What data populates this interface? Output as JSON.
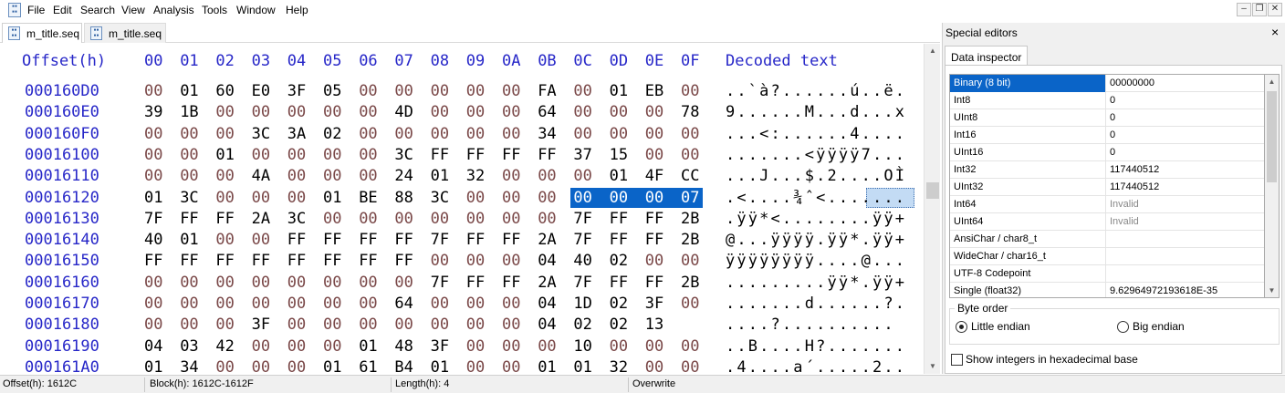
{
  "menu": [
    "File",
    "Edit",
    "Search",
    "View",
    "Analysis",
    "Tools",
    "Window",
    "Help"
  ],
  "window_controls": {
    "minimize": "–",
    "restore": "❐",
    "close": "✕"
  },
  "tabs": [
    {
      "label": "m_title.seq",
      "active": true
    },
    {
      "label": "m_title.seq",
      "active": false
    }
  ],
  "hex": {
    "header_offset": "Offset(h)",
    "columns": [
      "00",
      "01",
      "02",
      "03",
      "04",
      "05",
      "06",
      "07",
      "08",
      "09",
      "0A",
      "0B",
      "0C",
      "0D",
      "0E",
      "0F"
    ],
    "header_text": "Decoded text",
    "rows": [
      {
        "offset": "000160D0",
        "bytes": [
          "00",
          "01",
          "60",
          "E0",
          "3F",
          "05",
          "00",
          "00",
          "00",
          "00",
          "00",
          "FA",
          "00",
          "01",
          "EB",
          "00"
        ],
        "text": "..`à?......ú..ë."
      },
      {
        "offset": "000160E0",
        "bytes": [
          "39",
          "1B",
          "00",
          "00",
          "00",
          "00",
          "00",
          "4D",
          "00",
          "00",
          "00",
          "64",
          "00",
          "00",
          "00",
          "78"
        ],
        "text": "9......M...d...x"
      },
      {
        "offset": "000160F0",
        "bytes": [
          "00",
          "00",
          "00",
          "3C",
          "3A",
          "02",
          "00",
          "00",
          "00",
          "00",
          "00",
          "34",
          "00",
          "00",
          "00",
          "00"
        ],
        "text": "...<:......4...."
      },
      {
        "offset": "00016100",
        "bytes": [
          "00",
          "00",
          "01",
          "00",
          "00",
          "00",
          "00",
          "3C",
          "FF",
          "FF",
          "FF",
          "FF",
          "37",
          "15",
          "00",
          "00"
        ],
        "text": ".......<ÿÿÿÿ7..."
      },
      {
        "offset": "00016110",
        "bytes": [
          "00",
          "00",
          "00",
          "4A",
          "00",
          "00",
          "00",
          "24",
          "01",
          "32",
          "00",
          "00",
          "00",
          "01",
          "4F",
          "CC"
        ],
        "text": "...J...$.2....OÌ"
      },
      {
        "offset": "00016120",
        "bytes": [
          "01",
          "3C",
          "00",
          "00",
          "00",
          "01",
          "BE",
          "88",
          "3C",
          "00",
          "00",
          "00",
          "00",
          "00",
          "00",
          "07"
        ],
        "text": ".<....¾ˆ<......."
      },
      {
        "offset": "00016130",
        "bytes": [
          "7F",
          "FF",
          "FF",
          "2A",
          "3C",
          "00",
          "00",
          "00",
          "00",
          "00",
          "00",
          "00",
          "7F",
          "FF",
          "FF",
          "2B"
        ],
        "text": ".ÿÿ*<........ÿÿ+"
      },
      {
        "offset": "00016140",
        "bytes": [
          "40",
          "01",
          "00",
          "00",
          "FF",
          "FF",
          "FF",
          "FF",
          "7F",
          "FF",
          "FF",
          "2A",
          "7F",
          "FF",
          "FF",
          "2B"
        ],
        "text": "@...ÿÿÿÿ.ÿÿ*.ÿÿ+"
      },
      {
        "offset": "00016150",
        "bytes": [
          "FF",
          "FF",
          "FF",
          "FF",
          "FF",
          "FF",
          "FF",
          "FF",
          "00",
          "00",
          "00",
          "04",
          "40",
          "02",
          "00",
          "00"
        ],
        "text": "ÿÿÿÿÿÿÿÿ....@..."
      },
      {
        "offset": "00016160",
        "bytes": [
          "00",
          "00",
          "00",
          "00",
          "00",
          "00",
          "00",
          "00",
          "7F",
          "FF",
          "FF",
          "2A",
          "7F",
          "FF",
          "FF",
          "2B"
        ],
        "text": ".........ÿÿ*.ÿÿ+"
      },
      {
        "offset": "00016170",
        "bytes": [
          "00",
          "00",
          "00",
          "00",
          "00",
          "00",
          "00",
          "64",
          "00",
          "00",
          "00",
          "04",
          "1D",
          "02",
          "3F",
          "00"
        ],
        "text": ".......d......?."
      },
      {
        "offset": "00016180",
        "bytes": [
          "00",
          "00",
          "00",
          "3F",
          "00",
          "00",
          "00",
          "00",
          "00",
          "00",
          "00",
          "04",
          "02",
          "02",
          "13"
        ],
        "text": "....?.........."
      },
      {
        "offset": "00016190",
        "bytes": [
          "04",
          "03",
          "42",
          "00",
          "00",
          "00",
          "01",
          "48",
          "3F",
          "00",
          "00",
          "00",
          "10",
          "00",
          "00",
          "00"
        ],
        "text": "..B....H?......."
      },
      {
        "offset": "000161A0",
        "bytes": [
          "01",
          "34",
          "00",
          "00",
          "00",
          "01",
          "61",
          "B4",
          "01",
          "00",
          "00",
          "01",
          "01",
          "32",
          "00",
          "00"
        ],
        "text": ".4....a´.....2.."
      }
    ]
  },
  "special_editors": {
    "title": "Special editors",
    "close": "×",
    "tab": "Data inspector",
    "rows": [
      {
        "label": "Binary (8 bit)",
        "value": "00000000",
        "selected": true
      },
      {
        "label": "Int8",
        "value": "0"
      },
      {
        "label": "UInt8",
        "value": "0"
      },
      {
        "label": "Int16",
        "value": "0"
      },
      {
        "label": "UInt16",
        "value": "0"
      },
      {
        "label": "Int32",
        "value": "117440512"
      },
      {
        "label": "UInt32",
        "value": "117440512"
      },
      {
        "label": "Int64",
        "value": "Invalid",
        "invalid": true
      },
      {
        "label": "UInt64",
        "value": "Invalid",
        "invalid": true
      },
      {
        "label": "AnsiChar / char8_t",
        "value": ""
      },
      {
        "label": "WideChar / char16_t",
        "value": ""
      },
      {
        "label": "UTF-8 Codepoint",
        "value": ""
      },
      {
        "label": "Single (float32)",
        "value": "9.62964972193618E-35"
      }
    ],
    "byte_order": {
      "label": "Byte order",
      "little": "Little endian",
      "big": "Big endian",
      "selected": "little"
    },
    "hex_checkbox": {
      "label": "Show integers in hexadecimal base",
      "checked": false
    }
  },
  "status": {
    "offset": "Offset(h): 1612C",
    "block": "Block(h): 1612C-1612F",
    "length": "Length(h): 4",
    "mode": "Overwrite"
  },
  "colors": {
    "offset_blue": "#2727c8",
    "zero_byte": "#7a4848",
    "selection": "#0a64c8"
  }
}
